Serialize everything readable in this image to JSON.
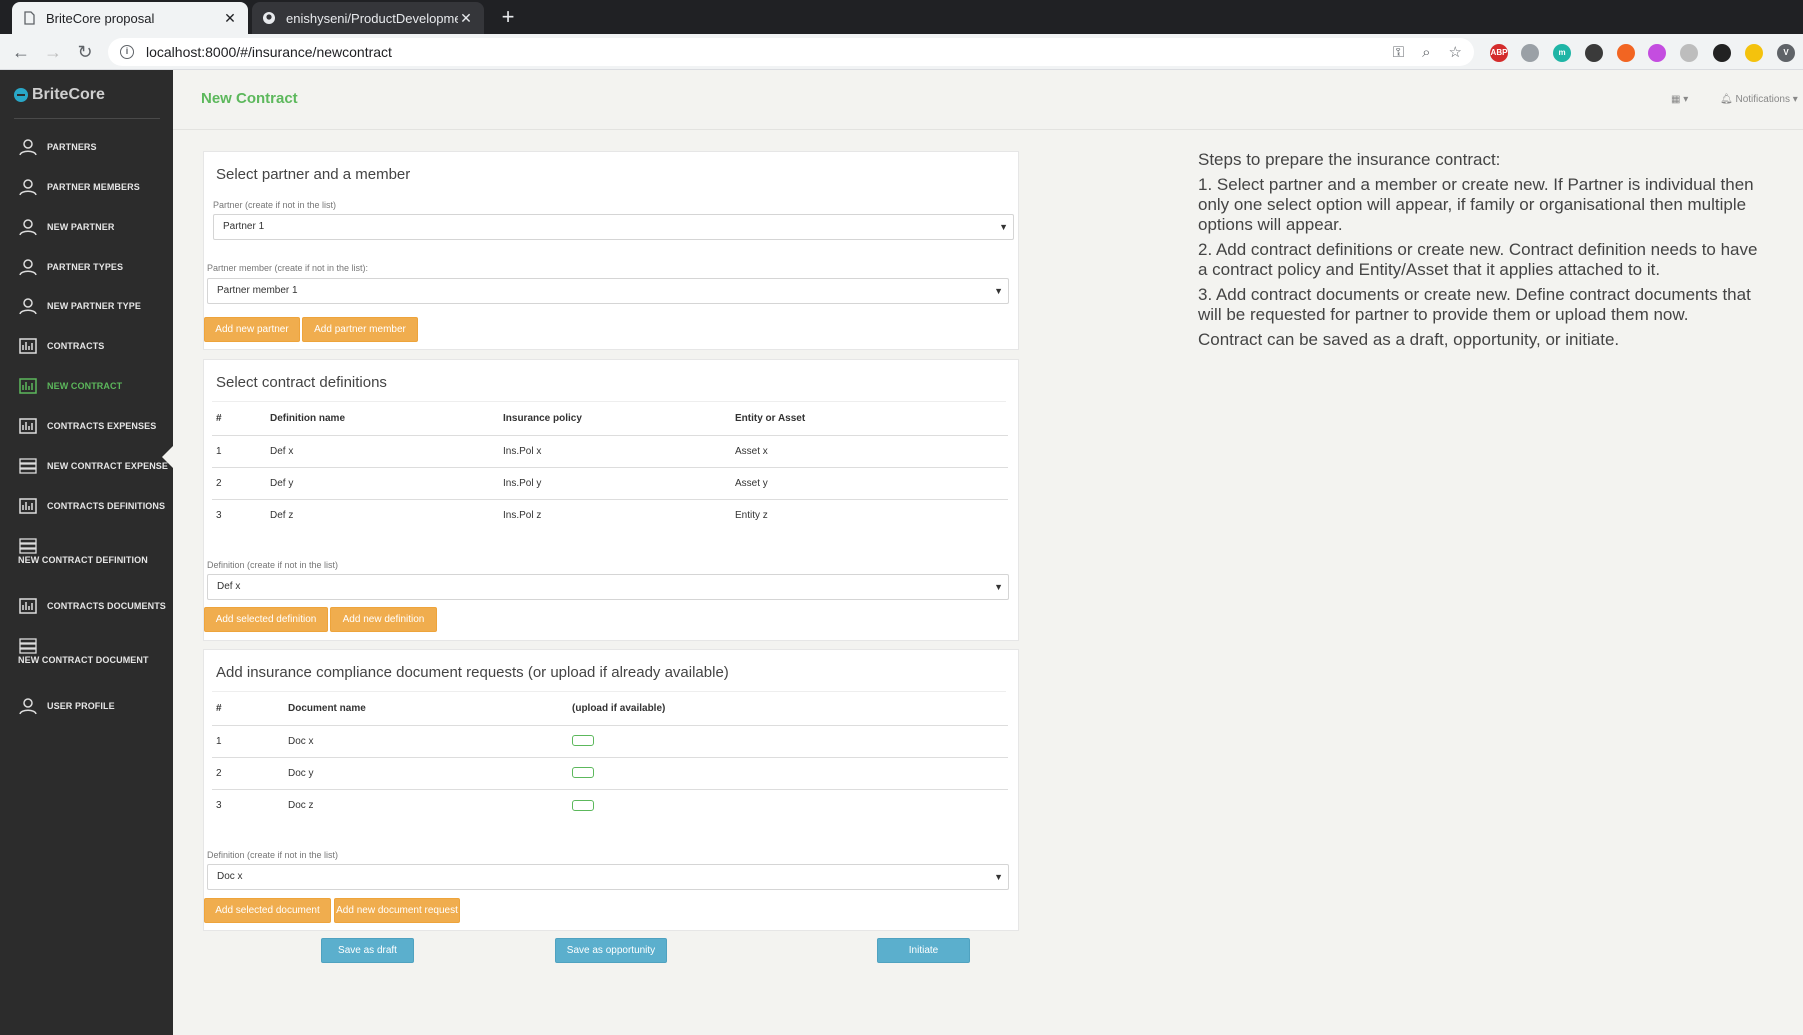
{
  "browser": {
    "tabs": [
      {
        "title": "BriteCore proposal",
        "active": true
      },
      {
        "title": "enishyseni/ProductDevelopment",
        "active": false
      }
    ],
    "close_glyph": "✕",
    "newtab_glyph": "+",
    "url": "localhost:8000/#/insurance/newcontract",
    "extensions": [
      {
        "name": "adblock-icon",
        "label": "ABP",
        "color": "#d42c2c"
      },
      {
        "name": "drive-icon",
        "label": "",
        "color": "#9aa0a6"
      },
      {
        "name": "m-icon",
        "label": "m",
        "color": "#1fb5a6"
      },
      {
        "name": "dark-circle-icon",
        "label": "",
        "color": "#3a3a3a"
      },
      {
        "name": "orange-x-icon",
        "label": "",
        "color": "#f26522"
      },
      {
        "name": "color-wheel-icon",
        "label": "",
        "color": "#c44de0"
      },
      {
        "name": "grey-square-icon",
        "label": "",
        "color": "#bdbdbd"
      },
      {
        "name": "black-circle-icon",
        "label": "",
        "color": "#222222"
      },
      {
        "name": "yellow-c-icon",
        "label": "",
        "color": "#f4c20d"
      },
      {
        "name": "v-icon",
        "label": "V",
        "color": "#5f6368"
      }
    ]
  },
  "sidebar": {
    "brand": "BriteCore",
    "items": [
      {
        "label": "PARTNERS",
        "icon": "user-icon",
        "active": false
      },
      {
        "label": "PARTNER MEMBERS",
        "icon": "user-icon",
        "active": false
      },
      {
        "label": "NEW PARTNER",
        "icon": "user-icon",
        "active": false
      },
      {
        "label": "PARTNER TYPES",
        "icon": "user-icon",
        "active": false
      },
      {
        "label": "NEW PARTNER TYPE",
        "icon": "user-icon",
        "active": false
      },
      {
        "label": "CONTRACTS",
        "icon": "chart-icon",
        "active": false
      },
      {
        "label": "NEW CONTRACT",
        "icon": "chart-icon",
        "active": true
      },
      {
        "label": "CONTRACTS EXPENSES",
        "icon": "chart-icon",
        "active": false
      },
      {
        "label": "NEW CONTRACT EXPENSE",
        "icon": "list-icon",
        "active": false
      },
      {
        "label": "CONTRACTS DEFINITIONS",
        "icon": "chart-icon",
        "active": false
      },
      {
        "label": "NEW CONTRACT DEFINITION",
        "icon": "list-icon",
        "active": false
      },
      {
        "label": "CONTRACTS DOCUMENTS",
        "icon": "chart-icon",
        "active": false
      },
      {
        "label": "NEW CONTRACT DOCUMENT",
        "icon": "list-icon",
        "active": false
      },
      {
        "label": "USER PROFILE",
        "icon": "user-icon",
        "active": false
      }
    ]
  },
  "header": {
    "title": "New Contract",
    "notifications_label": "Notifications"
  },
  "partner_card": {
    "title": "Select partner and a member",
    "partner_label": "Partner (create if not in the list)",
    "partner_value": "Partner 1",
    "member_label": "Partner member (create if not in the list):",
    "member_value": "Partner member 1",
    "add_partner": "Add new partner",
    "add_member": "Add partner member"
  },
  "definitions_card": {
    "title": "Select contract definitions",
    "columns": [
      "#",
      "Definition name",
      "Insurance policy",
      "Entity or Asset"
    ],
    "rows": [
      [
        "1",
        "Def x",
        "Ins.Pol x",
        "Asset x"
      ],
      [
        "2",
        "Def y",
        "Ins.Pol y",
        "Asset y"
      ],
      [
        "3",
        "Def z",
        "Ins.Pol z",
        "Entity z"
      ]
    ],
    "select_label": "Definition (create if not in the list)",
    "select_value": "Def x",
    "add_selected": "Add selected definition",
    "add_new": "Add new definition"
  },
  "documents_card": {
    "title": "Add insurance compliance document requests (or upload if already available)",
    "columns": [
      "#",
      "Document name",
      "(upload if available)"
    ],
    "rows": [
      [
        "1",
        "Doc x"
      ],
      [
        "2",
        "Doc y"
      ],
      [
        "3",
        "Doc z"
      ]
    ],
    "select_label": "Definition (create if not in the list)",
    "select_value": "Doc x",
    "add_selected": "Add selected document",
    "add_new": "Add new document request"
  },
  "actions": {
    "save_draft": "Save as draft",
    "save_opportunity": "Save as opportunity",
    "initiate": "Initiate"
  },
  "steps": {
    "heading": "Steps to prepare the insurance contract:",
    "items": [
      "1. Select partner and a member or create new. If Partner is individual then only one select option will appear, if family or organisational then multiple options will appear.",
      "2. Add contract definitions or create new. Contract definition needs to have a contract policy and Entity/Asset that it applies attached to it.",
      "3. Add contract documents or create new. Define contract documents that will be requested for partner to provide them or upload them now.",
      "Contract can be saved as a draft, opportunity, or initiate."
    ]
  },
  "colors": {
    "accent_green": "#5cb85c",
    "button_orange": "#f0ad4e",
    "button_blue": "#5bafcd",
    "sidebar_bg": "#2c2c2c"
  }
}
